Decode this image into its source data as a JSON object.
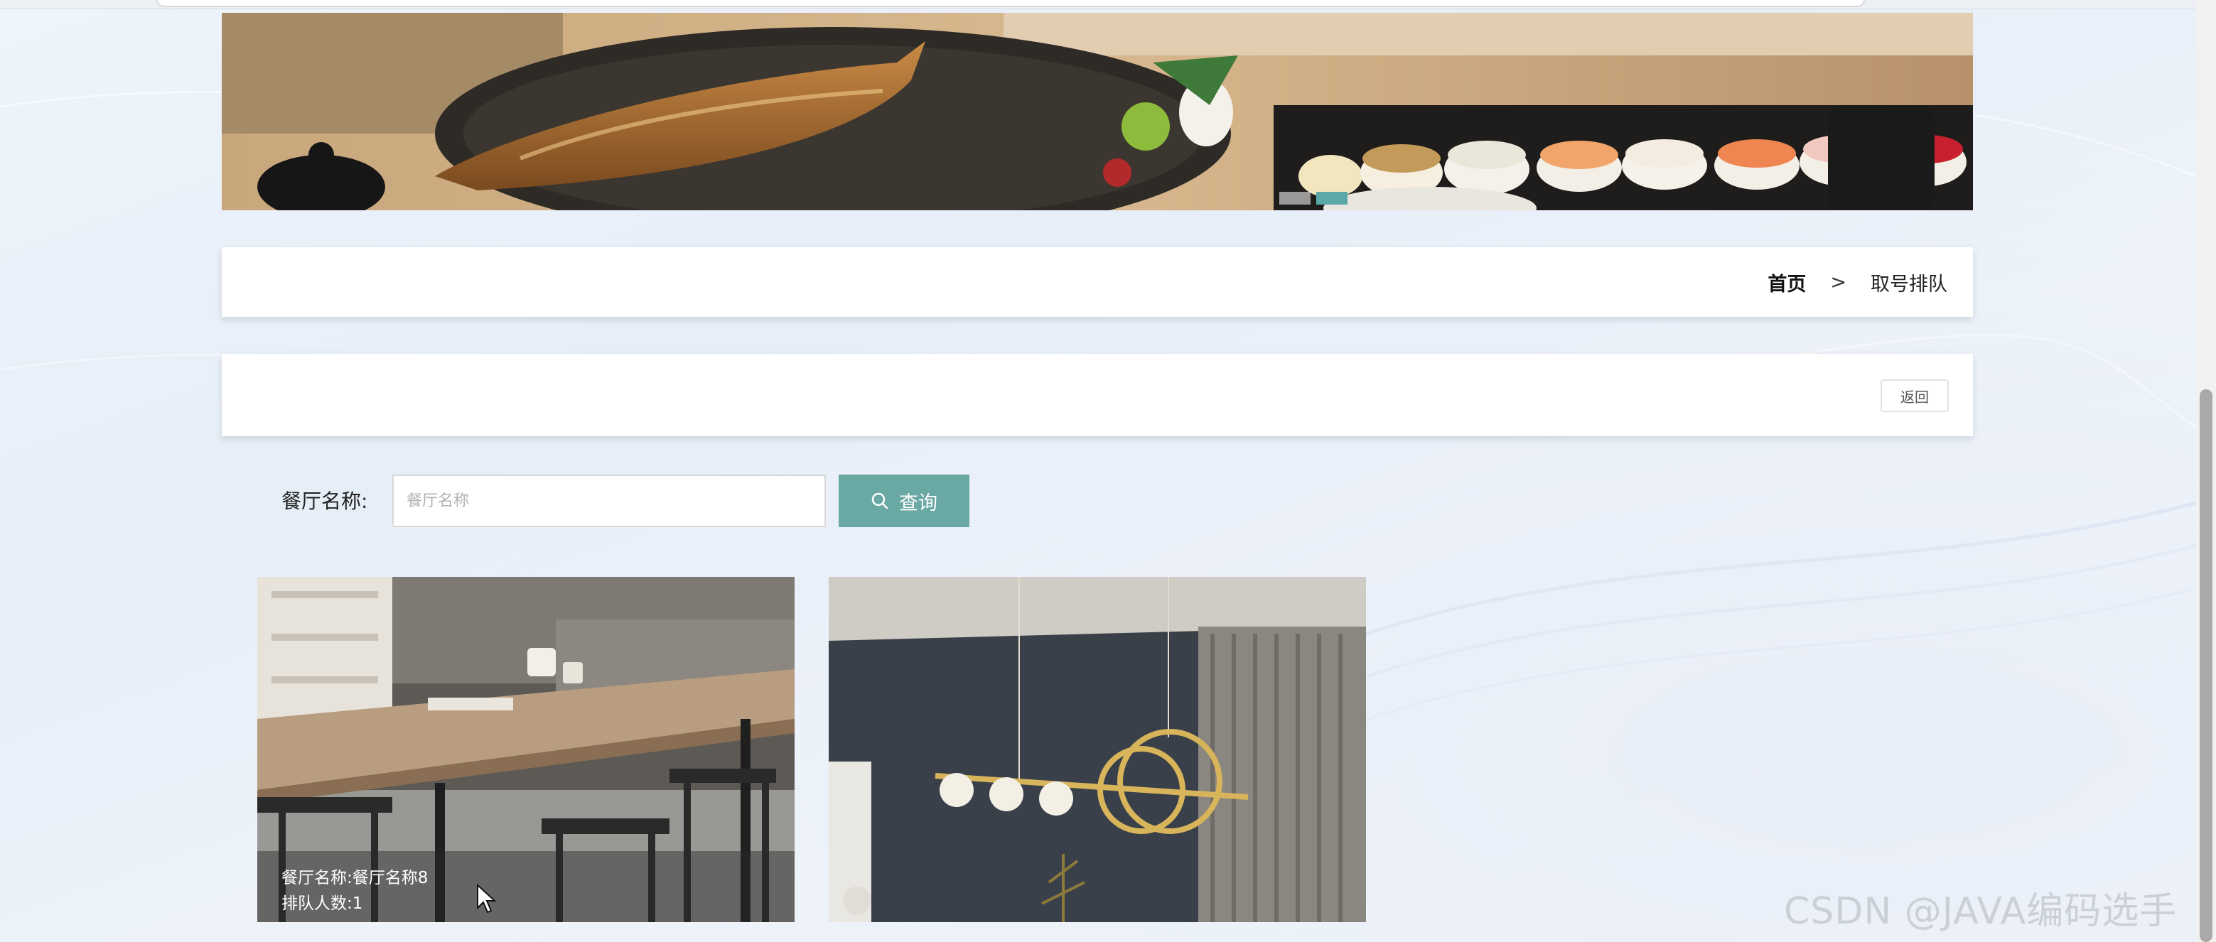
{
  "breadcrumb": {
    "home": "首页",
    "separator": ">",
    "current": "取号排队"
  },
  "actions": {
    "back_label": "返回"
  },
  "search": {
    "label": "餐厅名称:",
    "placeholder": "餐厅名称",
    "value": "",
    "button_label": "查询",
    "button_icon": "search-icon"
  },
  "cards": [
    {
      "name_line": "餐厅名称:餐厅名称8",
      "queue_line": "排队人数:1",
      "image": "dining-room-table"
    },
    {
      "image": "pendant-lamp-room"
    }
  ],
  "watermark": "CSDN @JAVA编码选手",
  "colors": {
    "accent": "#6aa8a4",
    "carousel_active": "#5aa9a8"
  }
}
